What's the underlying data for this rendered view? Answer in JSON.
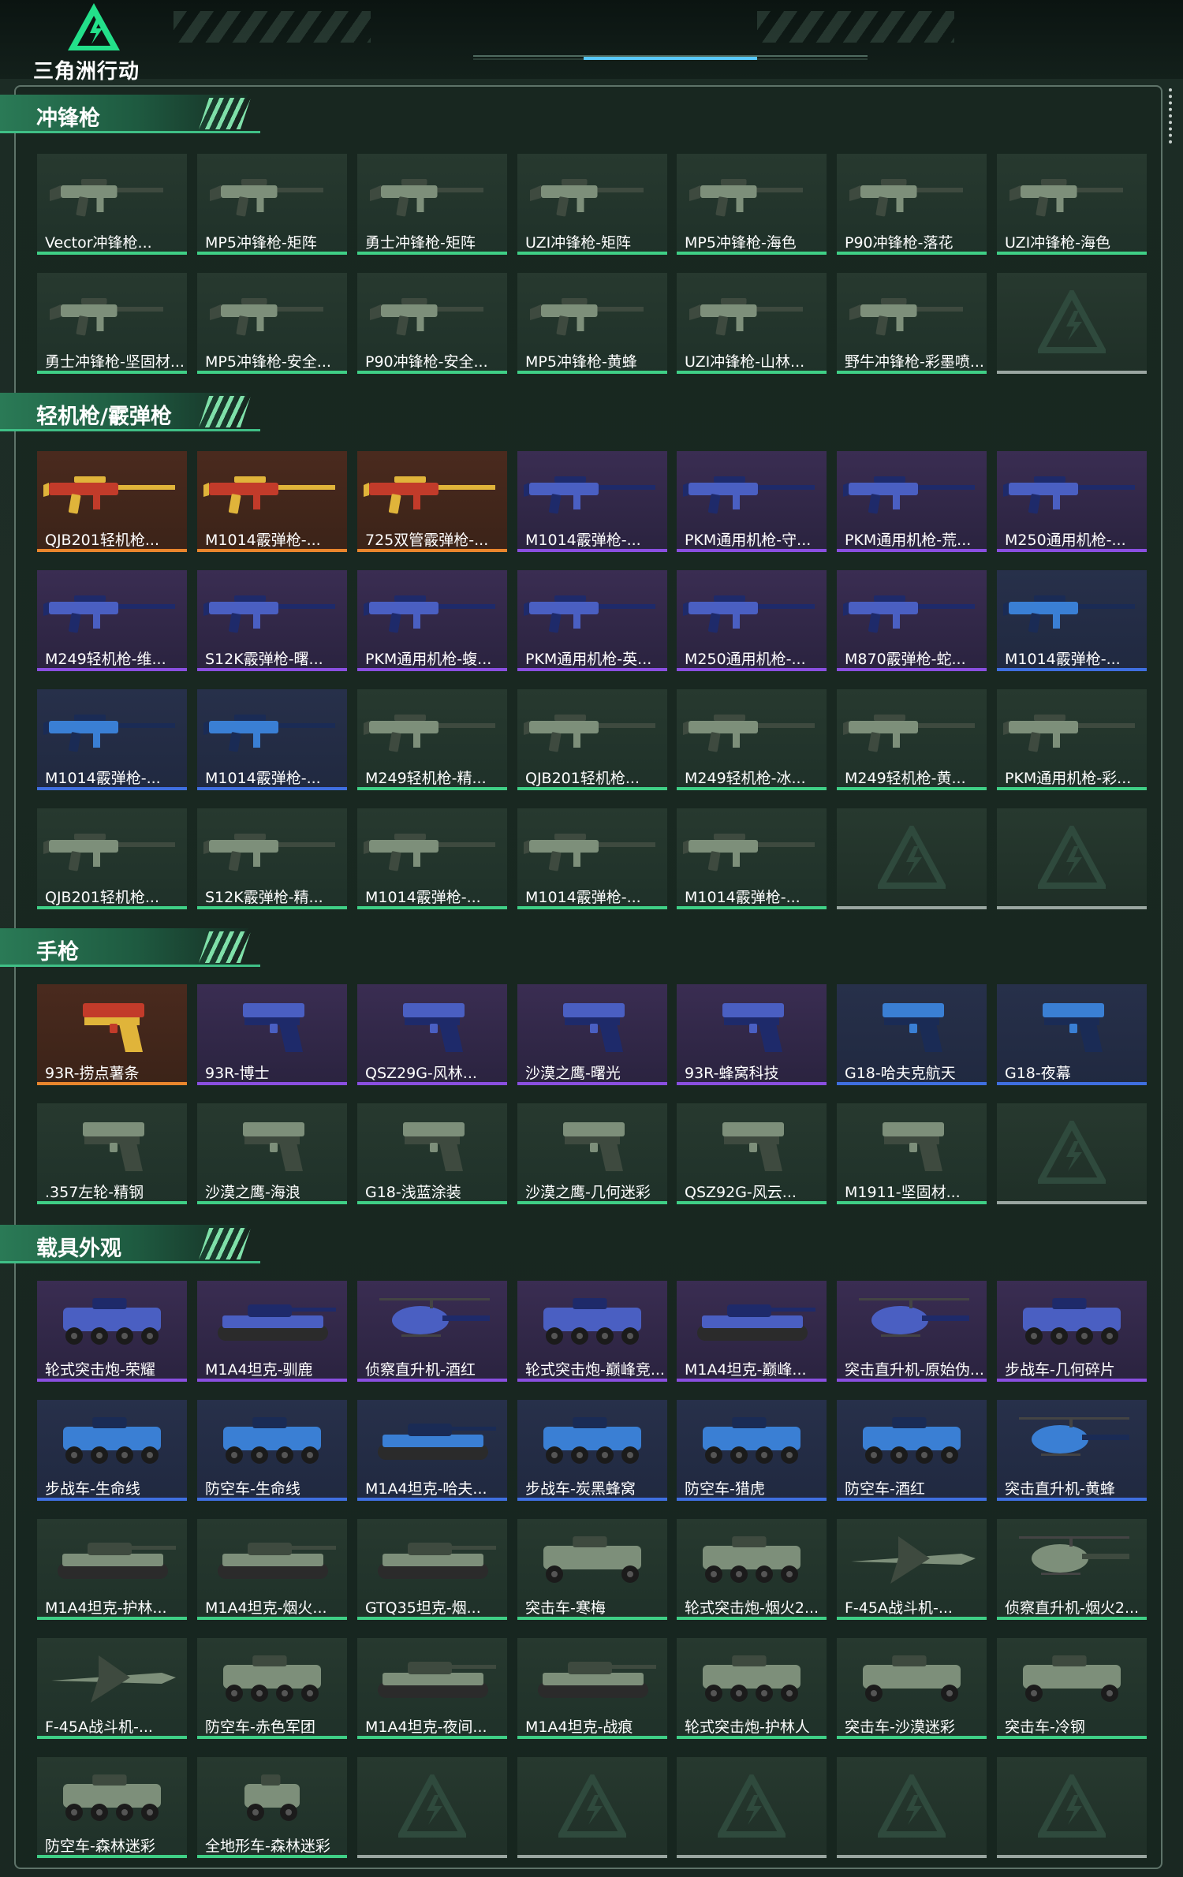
{
  "app": {
    "logo_text": "三角洲行动",
    "logo_icon": "delta-triangle-logo-icon"
  },
  "colors": {
    "green_rarity": "#3fcf86",
    "purple_rarity": "#8a4fe0",
    "gold_rarity": "#e9862d",
    "blue_rarity": "#3f6fe0",
    "empty_slot": "#9aa6a1",
    "section_header": "#2a7a56"
  },
  "sections": [
    {
      "title": "冲锋枪",
      "items": [
        {
          "name": "Vector冲锋枪...",
          "rarity": "green",
          "icon": "smg-icon"
        },
        {
          "name": "MP5冲锋枪-矩阵",
          "rarity": "green",
          "icon": "smg-icon"
        },
        {
          "name": "勇士冲锋枪-矩阵",
          "rarity": "green",
          "icon": "smg-icon"
        },
        {
          "name": "UZI冲锋枪-矩阵",
          "rarity": "green",
          "icon": "smg-icon"
        },
        {
          "name": "MP5冲锋枪-海色",
          "rarity": "green",
          "icon": "smg-icon"
        },
        {
          "name": "P90冲锋枪-落花",
          "rarity": "green",
          "icon": "smg-icon"
        },
        {
          "name": "UZI冲锋枪-海色",
          "rarity": "green",
          "icon": "smg-icon"
        },
        {
          "name": "勇士冲锋枪-坚固材...",
          "rarity": "green",
          "icon": "smg-icon"
        },
        {
          "name": "MP5冲锋枪-安全...",
          "rarity": "green",
          "icon": "smg-icon"
        },
        {
          "name": "P90冲锋枪-安全...",
          "rarity": "green",
          "icon": "smg-icon"
        },
        {
          "name": "MP5冲锋枪-黄蜂",
          "rarity": "green",
          "icon": "smg-icon"
        },
        {
          "name": "UZI冲锋枪-山林...",
          "rarity": "green",
          "icon": "smg-icon"
        },
        {
          "name": "野牛冲锋枪-彩墨喷...",
          "rarity": "green",
          "icon": "smg-icon"
        },
        {
          "name": "",
          "rarity": "empty",
          "icon": "empty-slot-icon"
        }
      ]
    },
    {
      "title": "轻机枪/霰弹枪",
      "items": [
        {
          "name": "QJB201轻机枪...",
          "rarity": "gold",
          "icon": "lmg-icon"
        },
        {
          "name": "M1014霰弹枪-...",
          "rarity": "gold",
          "icon": "shotgun-icon"
        },
        {
          "name": "725双管霰弹枪-...",
          "rarity": "gold",
          "icon": "shotgun-icon"
        },
        {
          "name": "M1014霰弹枪-...",
          "rarity": "purple",
          "icon": "shotgun-icon"
        },
        {
          "name": "PKM通用机枪-守...",
          "rarity": "purple",
          "icon": "lmg-icon"
        },
        {
          "name": "PKM通用机枪-荒...",
          "rarity": "purple",
          "icon": "lmg-icon"
        },
        {
          "name": "M250通用机枪-...",
          "rarity": "purple",
          "icon": "lmg-icon"
        },
        {
          "name": "M249轻机枪-维...",
          "rarity": "purple",
          "icon": "lmg-icon"
        },
        {
          "name": "S12K霰弹枪-曙...",
          "rarity": "purple",
          "icon": "shotgun-icon"
        },
        {
          "name": "PKM通用机枪-蝮...",
          "rarity": "purple",
          "icon": "lmg-icon"
        },
        {
          "name": "PKM通用机枪-英...",
          "rarity": "purple",
          "icon": "lmg-icon"
        },
        {
          "name": "M250通用机枪-...",
          "rarity": "purple",
          "icon": "lmg-icon"
        },
        {
          "name": "M870霰弹枪-蛇...",
          "rarity": "purple",
          "icon": "shotgun-icon"
        },
        {
          "name": "M1014霰弹枪-...",
          "rarity": "blue",
          "icon": "shotgun-icon"
        },
        {
          "name": "M1014霰弹枪-...",
          "rarity": "blue",
          "icon": "shotgun-icon"
        },
        {
          "name": "M1014霰弹枪-...",
          "rarity": "blue",
          "icon": "shotgun-icon"
        },
        {
          "name": "M249轻机枪-精...",
          "rarity": "green",
          "icon": "lmg-icon"
        },
        {
          "name": "QJB201轻机枪...",
          "rarity": "green",
          "icon": "lmg-icon"
        },
        {
          "name": "M249轻机枪-冰...",
          "rarity": "green",
          "icon": "lmg-icon"
        },
        {
          "name": "M249轻机枪-黄...",
          "rarity": "green",
          "icon": "lmg-icon"
        },
        {
          "name": "PKM通用机枪-彩...",
          "rarity": "green",
          "icon": "lmg-icon"
        },
        {
          "name": "QJB201轻机枪...",
          "rarity": "green",
          "icon": "lmg-icon"
        },
        {
          "name": "S12K霰弹枪-精...",
          "rarity": "green",
          "icon": "shotgun-icon"
        },
        {
          "name": "M1014霰弹枪-...",
          "rarity": "green",
          "icon": "shotgun-icon"
        },
        {
          "name": "M1014霰弹枪-...",
          "rarity": "green",
          "icon": "shotgun-icon"
        },
        {
          "name": "M1014霰弹枪-...",
          "rarity": "green",
          "icon": "shotgun-icon"
        },
        {
          "name": "",
          "rarity": "empty",
          "icon": "empty-slot-icon"
        },
        {
          "name": "",
          "rarity": "empty",
          "icon": "empty-slot-icon"
        }
      ]
    },
    {
      "title": "手枪",
      "items": [
        {
          "name": "93R-捞点薯条",
          "rarity": "gold",
          "icon": "pistol-icon"
        },
        {
          "name": "93R-博士",
          "rarity": "purple",
          "icon": "pistol-icon"
        },
        {
          "name": "QSZ29G-风林...",
          "rarity": "purple",
          "icon": "pistol-icon"
        },
        {
          "name": "沙漠之鹰-曙光",
          "rarity": "purple",
          "icon": "pistol-icon"
        },
        {
          "name": "93R-蜂窝科技",
          "rarity": "purple",
          "icon": "pistol-icon"
        },
        {
          "name": "G18-哈夫克航天",
          "rarity": "blue",
          "icon": "pistol-icon"
        },
        {
          "name": "G18-夜幕",
          "rarity": "blue",
          "icon": "pistol-icon"
        },
        {
          "name": ".357左轮-精钢",
          "rarity": "green",
          "icon": "revolver-icon"
        },
        {
          "name": "沙漠之鹰-海浪",
          "rarity": "green",
          "icon": "pistol-icon"
        },
        {
          "name": "G18-浅蓝涂装",
          "rarity": "green",
          "icon": "pistol-icon"
        },
        {
          "name": "沙漠之鹰-几何迷彩",
          "rarity": "green",
          "icon": "pistol-icon"
        },
        {
          "name": "QSZ92G-风云...",
          "rarity": "green",
          "icon": "pistol-icon"
        },
        {
          "name": "M1911-坚固材...",
          "rarity": "green",
          "icon": "pistol-icon"
        },
        {
          "name": "",
          "rarity": "empty",
          "icon": "empty-slot-icon"
        }
      ]
    },
    {
      "title": "载具外观",
      "items": [
        {
          "name": "轮式突击炮-荣耀",
          "rarity": "purple",
          "icon": "armored-car-icon"
        },
        {
          "name": "M1A4坦克-驯鹿",
          "rarity": "purple",
          "icon": "tank-icon"
        },
        {
          "name": "侦察直升机-酒红",
          "rarity": "purple",
          "icon": "helicopter-icon"
        },
        {
          "name": "轮式突击炮-巅峰竞...",
          "rarity": "purple",
          "icon": "armored-car-icon"
        },
        {
          "name": "M1A4坦克-巅峰...",
          "rarity": "purple",
          "icon": "tank-icon"
        },
        {
          "name": "突击直升机-原始伪...",
          "rarity": "purple",
          "icon": "helicopter-icon"
        },
        {
          "name": "步战车-几何碎片",
          "rarity": "purple",
          "icon": "ifv-icon"
        },
        {
          "name": "步战车-生命线",
          "rarity": "blue",
          "icon": "ifv-icon"
        },
        {
          "name": "防空车-生命线",
          "rarity": "blue",
          "icon": "ifv-icon"
        },
        {
          "name": "M1A4坦克-哈夫...",
          "rarity": "blue",
          "icon": "tank-icon"
        },
        {
          "name": "步战车-炭黑蜂窝",
          "rarity": "blue",
          "icon": "ifv-icon"
        },
        {
          "name": "防空车-猎虎",
          "rarity": "blue",
          "icon": "ifv-icon"
        },
        {
          "name": "防空车-酒红",
          "rarity": "blue",
          "icon": "ifv-icon"
        },
        {
          "name": "突击直升机-黄蜂",
          "rarity": "blue",
          "icon": "helicopter-icon"
        },
        {
          "name": "M1A4坦克-护林...",
          "rarity": "green",
          "icon": "tank-icon"
        },
        {
          "name": "M1A4坦克-烟火...",
          "rarity": "green",
          "icon": "tank-icon"
        },
        {
          "name": "GTQ35坦克-烟...",
          "rarity": "green",
          "icon": "tank-icon"
        },
        {
          "name": "突击车-寒梅",
          "rarity": "green",
          "icon": "assault-vehicle-icon"
        },
        {
          "name": "轮式突击炮-烟火2...",
          "rarity": "green",
          "icon": "armored-car-icon"
        },
        {
          "name": "F-45A战斗机-...",
          "rarity": "green",
          "icon": "jet-icon"
        },
        {
          "name": "侦察直升机-烟火2...",
          "rarity": "green",
          "icon": "helicopter-icon"
        },
        {
          "name": "F-45A战斗机-...",
          "rarity": "green",
          "icon": "jet-icon"
        },
        {
          "name": "防空车-赤色军团",
          "rarity": "green",
          "icon": "ifv-icon"
        },
        {
          "name": "M1A4坦克-夜间...",
          "rarity": "green",
          "icon": "tank-icon"
        },
        {
          "name": "M1A4坦克-战痕",
          "rarity": "green",
          "icon": "tank-icon"
        },
        {
          "name": "轮式突击炮-护林人",
          "rarity": "green",
          "icon": "armored-car-icon"
        },
        {
          "name": "突击车-沙漠迷彩",
          "rarity": "green",
          "icon": "assault-vehicle-icon"
        },
        {
          "name": "突击车-冷钢",
          "rarity": "green",
          "icon": "assault-vehicle-icon"
        },
        {
          "name": "防空车-森林迷彩",
          "rarity": "green",
          "icon": "ifv-icon"
        },
        {
          "name": "全地形车-森林迷彩",
          "rarity": "green",
          "icon": "atv-icon"
        },
        {
          "name": "",
          "rarity": "empty",
          "icon": "empty-slot-icon"
        },
        {
          "name": "",
          "rarity": "empty",
          "icon": "empty-slot-icon"
        },
        {
          "name": "",
          "rarity": "empty",
          "icon": "empty-slot-icon"
        },
        {
          "name": "",
          "rarity": "empty",
          "icon": "empty-slot-icon"
        },
        {
          "name": "",
          "rarity": "empty",
          "icon": "empty-slot-icon"
        }
      ]
    }
  ]
}
